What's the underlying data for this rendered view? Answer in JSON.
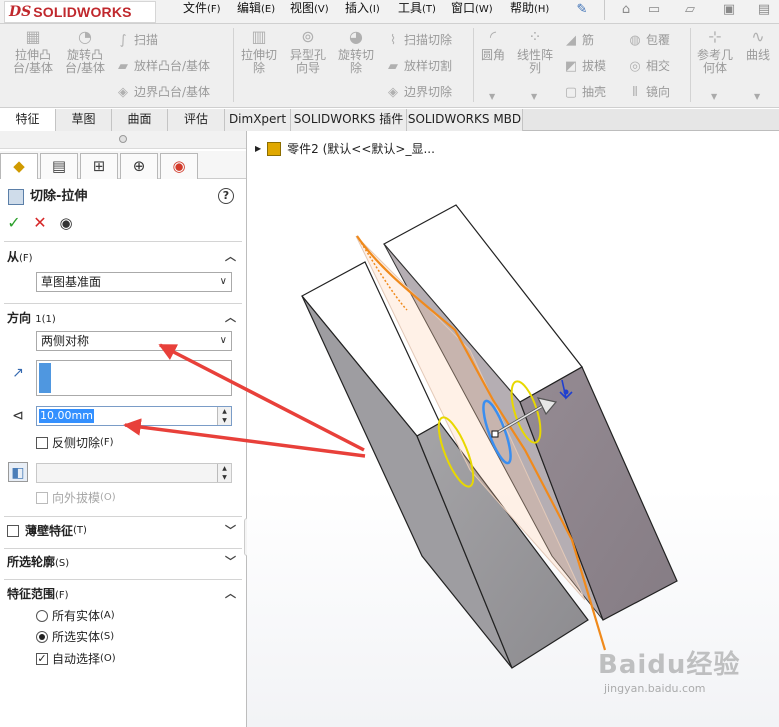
{
  "app": {
    "logo_ds": "DS",
    "logo_text": "SOLIDWORKS"
  },
  "menu": [
    {
      "label": "文件",
      "key": "(F)"
    },
    {
      "label": "编辑",
      "key": "(E)"
    },
    {
      "label": "视图",
      "key": "(V)"
    },
    {
      "label": "插入",
      "key": "(I)"
    },
    {
      "label": "工具",
      "key": "(T)"
    },
    {
      "label": "窗口",
      "key": "(W)"
    },
    {
      "label": "帮助",
      "key": "(H)"
    }
  ],
  "ribbon": {
    "extrude_boss": "拉伸凸台/基体",
    "revolve_boss": "旋转凸台/基体",
    "sweep": "扫描",
    "loft_boss": "放样凸台/基体",
    "boundary_boss": "边界凸台/基体",
    "extrude_cut": "拉伸切除",
    "hole_wizard": "异型孔向导",
    "revolve_cut": "旋转切除",
    "swept_cut": "扫描切除",
    "lofted_cut": "放样切割",
    "boundary_cut": "边界切除",
    "fillet": "圆角",
    "linear_pattern": "线性阵列",
    "rib": "筋",
    "draft": "拔模",
    "shell": "抽壳",
    "wrap": "包覆",
    "intersect": "相交",
    "mirror": "镜向",
    "ref_geometry": "参考几何体",
    "curves": "曲线"
  },
  "tabs": [
    "特征",
    "草图",
    "曲面",
    "评估",
    "DimXpert",
    "SOLIDWORKS 插件",
    "SOLIDWORKS MBD"
  ],
  "property_manager": {
    "title": "切除-拉伸",
    "help": "?",
    "from_group": {
      "label": "从",
      "key": "(F)",
      "value": "草图基准面"
    },
    "direction_group": {
      "label": "方向",
      "key": "1(1)",
      "end_condition": "两侧对称",
      "depth": "10.00mm",
      "flip_label": "反侧切除",
      "flip_key": "(F)",
      "draft_label": "向外拔模",
      "draft_key": "(O)"
    },
    "thin_feature": {
      "label": "薄壁特征",
      "key": "(T)"
    },
    "selected_contours": {
      "label": "所选轮廓",
      "key": "(S)"
    },
    "feature_scope": {
      "label": "特征范围",
      "key": "(F)",
      "all_bodies": "所有实体",
      "all_bodies_key": "(A)",
      "selected_bodies": "所选实体",
      "selected_bodies_key": "(S)",
      "auto_select": "自动选择",
      "auto_select_key": "(O)"
    }
  },
  "viewport": {
    "tree_node": "零件2 (默认<<默认>_显..."
  },
  "watermark": {
    "brand": "Baidu经验",
    "url": "jingyan.baidu.com"
  },
  "colors": {
    "accent_red": "#c0282d",
    "arrow_red": "#e8403a",
    "selection_blue": "#3390ff",
    "sketch_orange": "#f08a1c",
    "body_gray": "#8d8389"
  }
}
